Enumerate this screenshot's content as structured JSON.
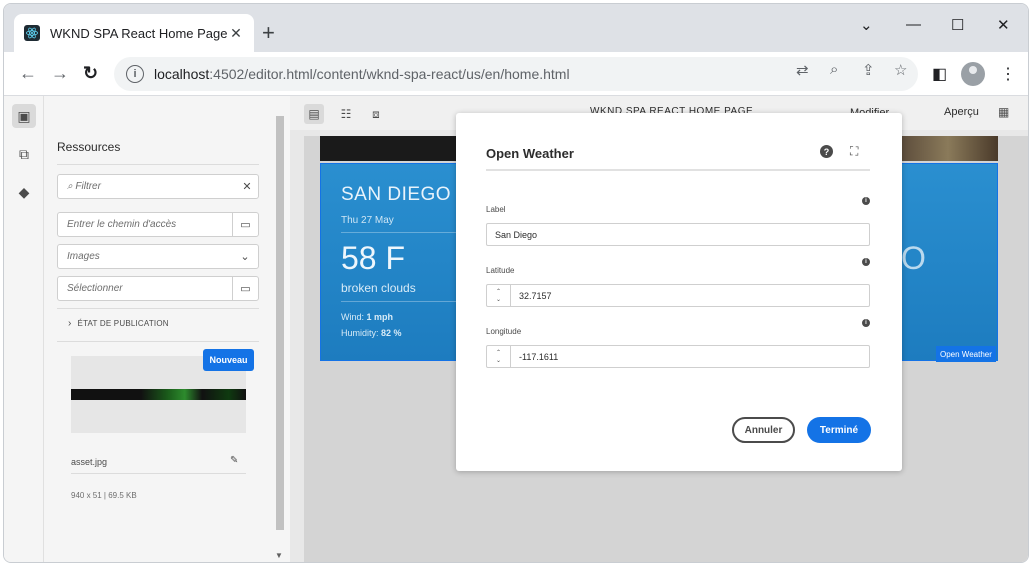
{
  "browser": {
    "tab_title": "WKND SPA React Home Page",
    "tab_close": "✕",
    "new_tab": "+",
    "url_host": "localhost",
    "url_path": ":4502/editor.html/content/wknd-spa-react/us/en/home.html",
    "window_controls": {
      "minimize": "—",
      "maximize": "☐",
      "close": "✕",
      "dropdown": "⌄"
    }
  },
  "rail": {
    "items": [
      "assets-icon",
      "components-icon",
      "layers-icon"
    ]
  },
  "panel": {
    "title": "Ressources",
    "filter_placeholder": "Filtrer",
    "path_placeholder": "Entrer le chemin d'accès",
    "type_value": "Images",
    "select_placeholder": "Sélectionner",
    "publication_state": "ÉTAT DE PUBLICATION",
    "asset": {
      "badge": "Nouveau",
      "name": "asset.jpg",
      "meta": "940 x 51 | 69.5 KB"
    }
  },
  "canvas_toolbar": {
    "page_title": "WKND SPA REACT HOME PAGE",
    "mode": "Modifier",
    "preview": "Aperçu"
  },
  "weather_component": {
    "city": "SAN DIEGO",
    "date": "Thu 27 May",
    "temperature": "58 F",
    "description": "broken clouds",
    "wind_label": "Wind: ",
    "wind_value": "1 mph",
    "humidity_label": "Humidity: ",
    "humidity_value": "82 %",
    "component_label": "Open Weather"
  },
  "dialog": {
    "title": "Open Weather",
    "fields": {
      "label": {
        "label": "Label",
        "value": "San Diego"
      },
      "latitude": {
        "label": "Latitude",
        "value": "32.7157"
      },
      "longitude": {
        "label": "Longitude",
        "value": "-117.1611"
      }
    },
    "cancel": "Annuler",
    "done": "Terminé"
  },
  "colors": {
    "accent": "#1473e6",
    "weather_bg": "#2a8fd0"
  }
}
